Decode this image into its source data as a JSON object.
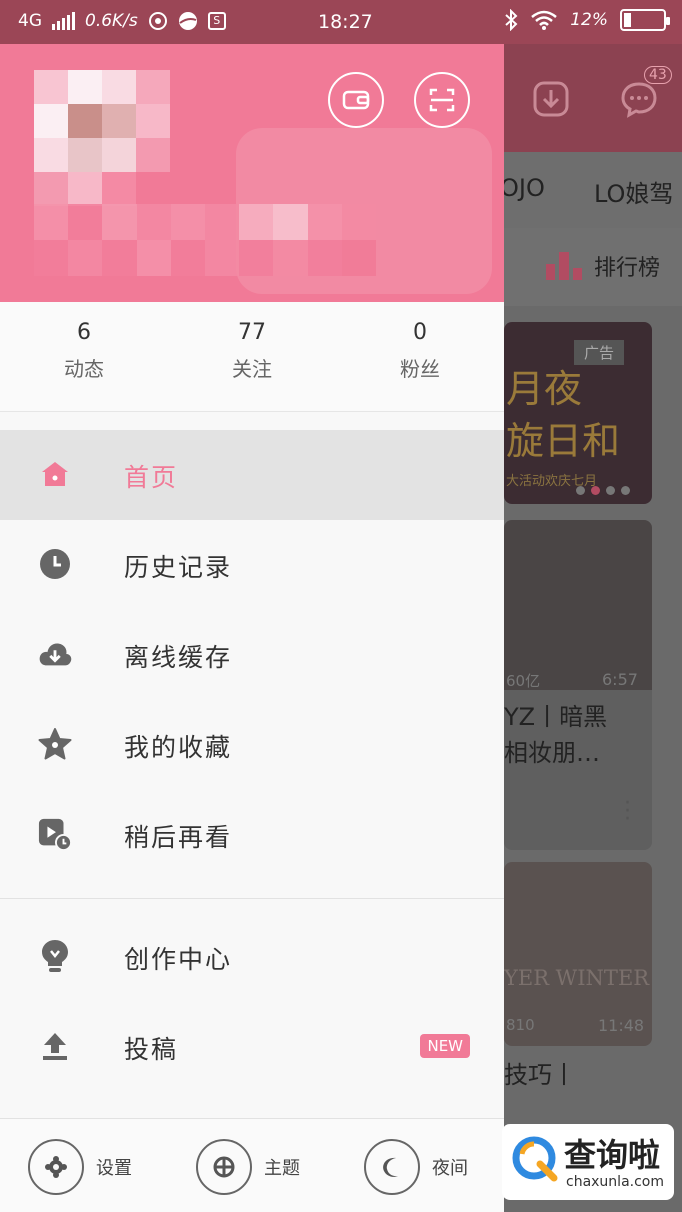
{
  "status_bar": {
    "network": "4G",
    "speed": "0.6K/s",
    "s_icon": "S",
    "time": "18:27",
    "battery": "12%"
  },
  "drawer": {
    "stats": [
      {
        "value": "6",
        "label": "动态"
      },
      {
        "value": "77",
        "label": "关注"
      },
      {
        "value": "0",
        "label": "粉丝"
      }
    ],
    "menu": [
      {
        "label": "首页",
        "icon": "home-icon",
        "active": true
      },
      {
        "label": "历史记录",
        "icon": "clock-icon"
      },
      {
        "label": "离线缓存",
        "icon": "cloud-download-icon"
      },
      {
        "label": "我的收藏",
        "icon": "star-icon"
      },
      {
        "label": "稍后再看",
        "icon": "watch-later-icon"
      }
    ],
    "menu2": [
      {
        "label": "创作中心",
        "icon": "lightbulb-icon"
      },
      {
        "label": "投稿",
        "icon": "upload-icon",
        "badge": "NEW"
      }
    ],
    "bottom": [
      {
        "label": "设置",
        "icon": "settings-icon"
      },
      {
        "label": "主题",
        "icon": "theme-icon"
      },
      {
        "label": "夜间",
        "icon": "moon-icon"
      }
    ]
  },
  "background_app": {
    "notification_count": "43",
    "tabs": [
      "OJO",
      "LO娘驾"
    ],
    "ranking_label": "排行榜",
    "ad_tag": "广告",
    "banner_text_1": "月夜",
    "banner_text_2": "旋日和",
    "banner_sub": "大活动欢庆七月",
    "card1_views": "60亿",
    "card1_duration": "6:57",
    "card1_title_1": "YZ丨暗黑",
    "card1_title_2": "相妆朋…",
    "card2_banner": "YER WINTER",
    "card2_views": "810",
    "card2_duration": "11:48",
    "card2_title": "技巧丨"
  },
  "watermark": {
    "brand": "查询啦",
    "domain": "chaxunla.com"
  },
  "colors": {
    "accent": "#f17a97",
    "status_bar": "#9b4656"
  }
}
